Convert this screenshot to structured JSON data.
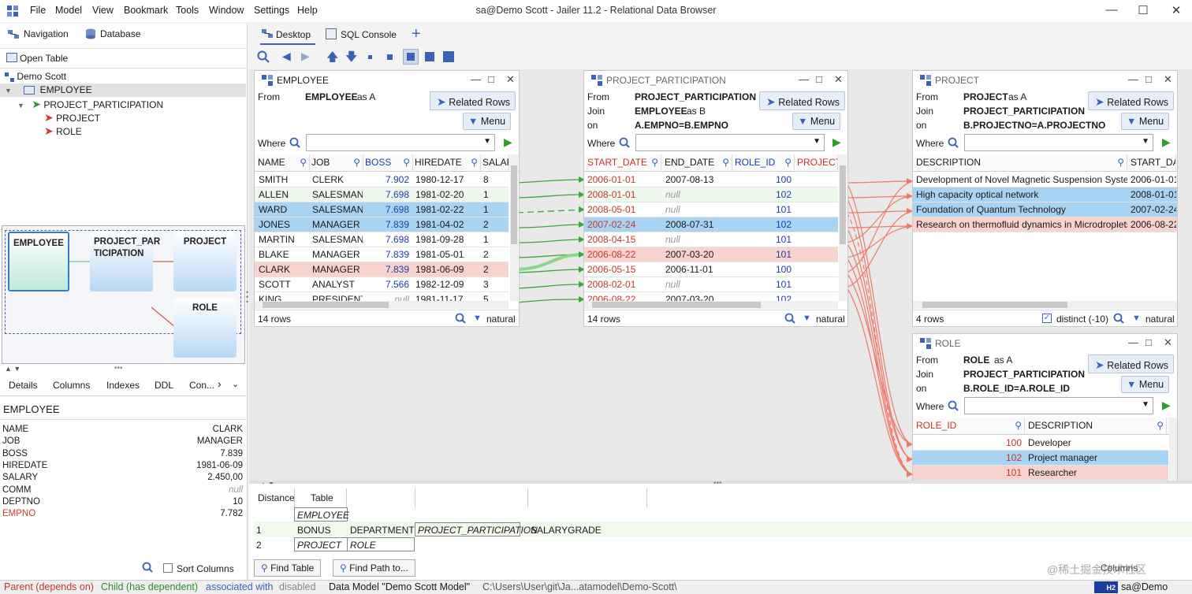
{
  "window": {
    "title": "sa@Demo Scott - Jailer 11.2 - Relational Data Browser",
    "menu": [
      "File",
      "Model",
      "View",
      "Bookmark",
      "Tools",
      "Window",
      "Settings",
      "Help"
    ]
  },
  "left": {
    "tabs": {
      "navigation": "Navigation",
      "database": "Database"
    },
    "open_table": "Open Table",
    "tree": {
      "root": "Demo Scott",
      "employee": "EMPLOYEE",
      "pp": "PROJECT_PARTICIPATION",
      "project": "PROJECT",
      "role": "ROLE"
    },
    "graph": {
      "employee": "EMPLOYEE",
      "pp": "PROJECT_PAR TICIPATION",
      "project": "PROJECT",
      "role": "ROLE"
    },
    "detail_tabs": {
      "details": "Details",
      "columns": "Columns",
      "indexes": "Indexes",
      "ddl": "DDL",
      "con": "Con..."
    },
    "detail_title": "EMPLOYEE",
    "details": [
      {
        "k": "NAME",
        "v": "CLARK"
      },
      {
        "k": "JOB",
        "v": "MANAGER"
      },
      {
        "k": "BOSS",
        "v": "7.839"
      },
      {
        "k": "HIREDATE",
        "v": "1981-06-09"
      },
      {
        "k": "SALARY",
        "v": "2.450,00"
      },
      {
        "k": "COMM",
        "v": "null"
      },
      {
        "k": "DEPTNO",
        "v": "10"
      },
      {
        "k": "EMPNO",
        "v": "7.782"
      }
    ],
    "sort_columns": "Sort Columns"
  },
  "desk_tabs": {
    "desktop": "Desktop",
    "sql": "SQL Console"
  },
  "employee": {
    "title": "EMPLOYEE",
    "from": "From",
    "table": "EMPLOYEE",
    "alias": "as A",
    "related": "Related Rows",
    "menu": "Menu",
    "where": "Where",
    "headers": [
      "NAME",
      "JOB",
      "BOSS",
      "HIREDATE",
      "SALAR"
    ],
    "rows": [
      [
        "SMITH",
        "CLERK",
        "7.902",
        "1980-12-17",
        "8"
      ],
      [
        "ALLEN",
        "SALESMAN",
        "7.698",
        "1981-02-20",
        "1"
      ],
      [
        "WARD",
        "SALESMAN",
        "7.698",
        "1981-02-22",
        "1"
      ],
      [
        "JONES",
        "MANAGER",
        "7.839",
        "1981-04-02",
        "2"
      ],
      [
        "MARTIN",
        "SALESMAN",
        "7.698",
        "1981-09-28",
        "1"
      ],
      [
        "BLAKE",
        "MANAGER",
        "7.839",
        "1981-05-01",
        "2"
      ],
      [
        "CLARK",
        "MANAGER",
        "7.839",
        "1981-06-09",
        "2"
      ],
      [
        "SCOTT",
        "ANALYST",
        "7.566",
        "1982-12-09",
        "3"
      ],
      [
        "KING",
        "PRESIDENT",
        "null",
        "1981-11-17",
        "5"
      ]
    ],
    "rowcount": "14 rows",
    "order": "natural"
  },
  "pp": {
    "title": "PROJECT_PARTICIPATION",
    "from": "From",
    "table": "PROJECT_PARTICIPATION",
    "join": "Join",
    "jtable": "EMPLOYEE",
    "jalias": "as B",
    "on": "on",
    "cond": "A.EMPNO=B.EMPNO",
    "related": "Related Rows",
    "menu": "Menu",
    "where": "Where",
    "headers": [
      "START_DATE",
      "END_DATE",
      "ROLE_ID",
      "PROJECTN"
    ],
    "rows": [
      [
        "2006-01-01",
        "2007-08-13",
        "100"
      ],
      [
        "2008-01-01",
        "null",
        "102"
      ],
      [
        "2008-05-01",
        "null",
        "101"
      ],
      [
        "2007-02-24",
        "2008-07-31",
        "102"
      ],
      [
        "2008-04-15",
        "null",
        "101"
      ],
      [
        "2006-08-22",
        "2007-03-20",
        "101"
      ],
      [
        "2006-05-15",
        "2006-11-01",
        "100"
      ],
      [
        "2008-02-01",
        "null",
        "101"
      ],
      [
        "2006-08-22",
        "2007-03-20",
        "102"
      ]
    ],
    "rowcount": "14 rows",
    "order": "natural"
  },
  "project": {
    "title": "PROJECT",
    "from": "From",
    "table": "PROJECT",
    "alias": "as A",
    "join": "Join",
    "jtable": "PROJECT_PARTICIPATION",
    "on": "on",
    "cond": "B.PROJECTNO=A.PROJECTNO",
    "related": "Related Rows",
    "menu": "Menu",
    "where": "Where",
    "headers": [
      "DESCRIPTION",
      "START_DAT"
    ],
    "rows": [
      [
        "Development of Novel Magnetic Suspension System",
        "2006-01-01"
      ],
      [
        "High capacity optical network",
        "2008-01-01"
      ],
      [
        "Foundation of Quantum Technology",
        "2007-02-24"
      ],
      [
        "Research on thermofluid dynamics in Microdroplets",
        "2006-08-22"
      ]
    ],
    "rowcount": "4 rows",
    "distinct": "distinct (-10)",
    "order": "natural"
  },
  "role": {
    "title": "ROLE",
    "from": "From",
    "table": "ROLE",
    "alias": "as A",
    "join": "Join",
    "jtable": "PROJECT_PARTICIPATION",
    "on": "on",
    "cond": "B.ROLE_ID=A.ROLE_ID",
    "related": "Related Rows",
    "menu": "Menu",
    "where": "Where",
    "headers": [
      "ROLE_ID",
      "DESCRIPTION"
    ],
    "rows": [
      [
        "100",
        "Developer"
      ],
      [
        "102",
        "Project manager"
      ],
      [
        "101",
        "Researcher"
      ]
    ]
  },
  "path": {
    "headers": {
      "distance": "Distance",
      "table": "Table"
    },
    "r0": "EMPLOYEE",
    "r1": {
      "d": "1",
      "a": "BONUS",
      "b": "DEPARTMENT",
      "c": "PROJECT_PARTICIPATION",
      "e": "SALARYGRADE"
    },
    "r2": {
      "d": "2",
      "a": "PROJECT",
      "b": "ROLE"
    },
    "find_table": "Find Table",
    "find_path": "Find Path to..."
  },
  "status": {
    "parent": "Parent (depends on)",
    "child": "Child (has dependent)",
    "assoc": "associated with",
    "disabled": "disabled",
    "model": "Data Model \"Demo Scott Model\"",
    "path": "C:\\Users\\User\\git\\Ja...atamodel\\Demo-Scott\\",
    "db": "H2",
    "conn": "sa@Demo Scott",
    "columns": "Columns",
    "watermark": "@稀土掘金技术社区"
  }
}
